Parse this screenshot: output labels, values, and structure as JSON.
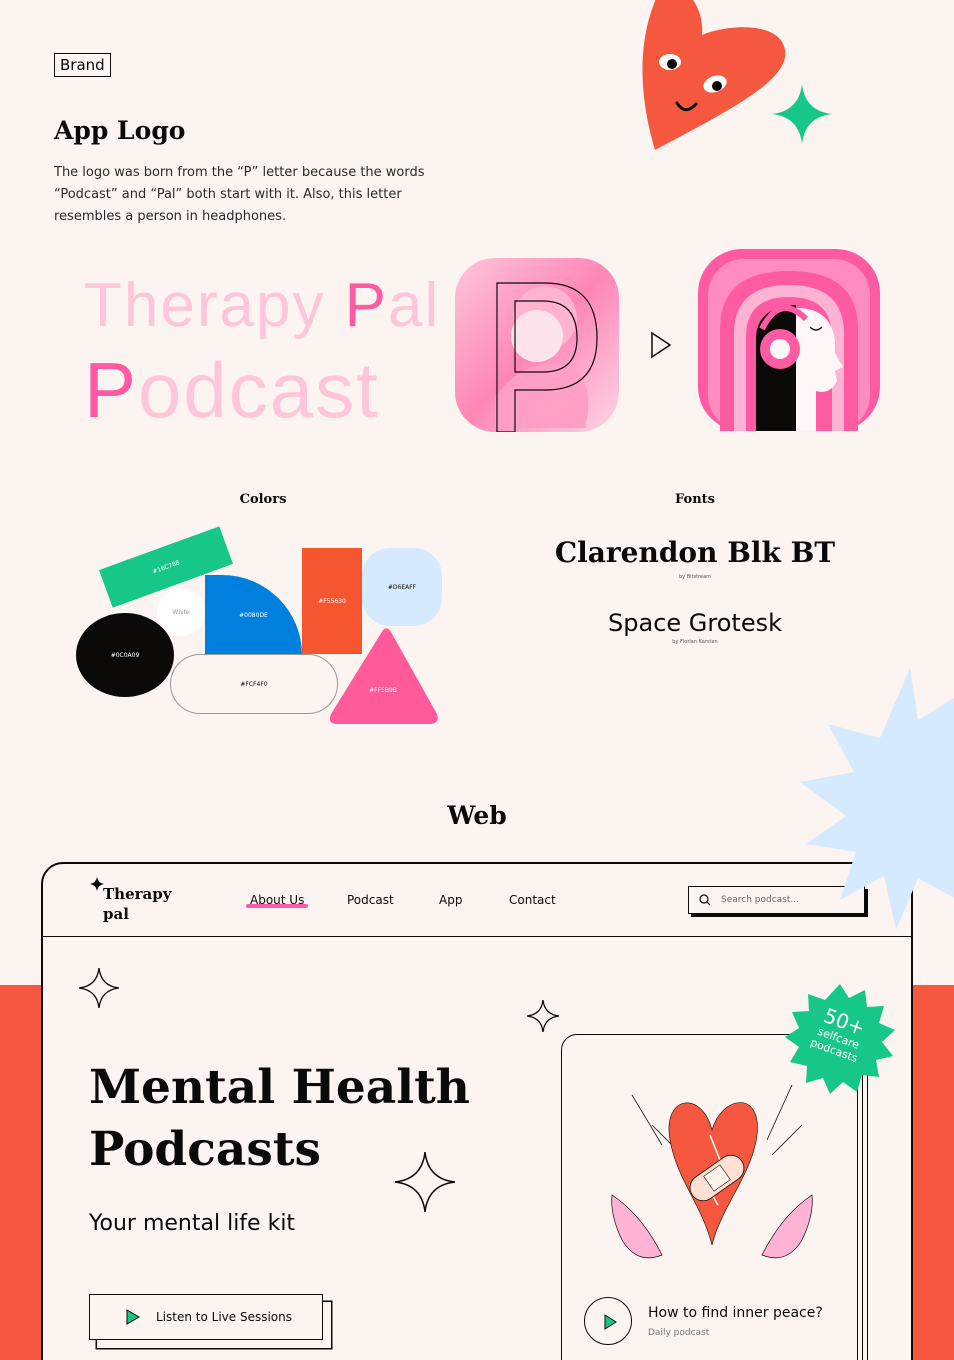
{
  "brand": {
    "tag": "Brand",
    "title": "App Logo",
    "description": "The logo was born from the “P” letter because the words “Podcast” and “Pal” both start with it.  Also, this letter resembles a person in headphones.",
    "wordmark": {
      "line1_part1": "Therapy ",
      "line1_accent": "P",
      "line1_part2": "al",
      "line2_accent": "P",
      "line2_part2": "odcast"
    }
  },
  "colors": {
    "label": "Colors",
    "swatches": [
      {
        "hex": "#16C788",
        "label": "#16C788"
      },
      {
        "hex": "#FFFFFF",
        "label": "White"
      },
      {
        "hex": "#0080DE",
        "label": "#0080DE"
      },
      {
        "hex": "#F55630",
        "label": "#F55630"
      },
      {
        "hex": "#D6EAFF",
        "label": "#D6EAFF"
      },
      {
        "hex": "#0C0A09",
        "label": "#0C0A09"
      },
      {
        "hex": "#FCF4F0",
        "label": "#FCF4F0"
      },
      {
        "hex": "#FF5B9B",
        "label": "#FF5B9B"
      }
    ]
  },
  "fonts": {
    "label": "Fonts",
    "primary": {
      "name": "Clarendon Blk BT",
      "credit": "by Bitstream"
    },
    "secondary": {
      "name": "Space Grotesk",
      "credit": "by Florian Karsten"
    }
  },
  "web": {
    "title": "Web",
    "nav": {
      "logo_line1": "Therapy",
      "logo_line2": "pal",
      "links": [
        "About Us",
        "Podcast",
        "App",
        "Contact"
      ],
      "search_placeholder": "Search podcast..."
    },
    "hero": {
      "title_line1": "Mental Health",
      "title_line2": "Podcasts",
      "subtitle": "Your mental life kit",
      "cta_label": "Listen to Live Sessions"
    },
    "badge": {
      "number": "50+",
      "line1": "selfcare",
      "line2": "podcasts"
    },
    "card": {
      "title": "How to find inner peace?",
      "subtitle": "Daily podcast"
    }
  },
  "accent_colors": {
    "pink": "#FF5BA2",
    "red": "#F5573F",
    "green": "#16C788",
    "blue": "#D6EAFF",
    "ink": "#0C0A09",
    "background": "#FCF4F0"
  }
}
